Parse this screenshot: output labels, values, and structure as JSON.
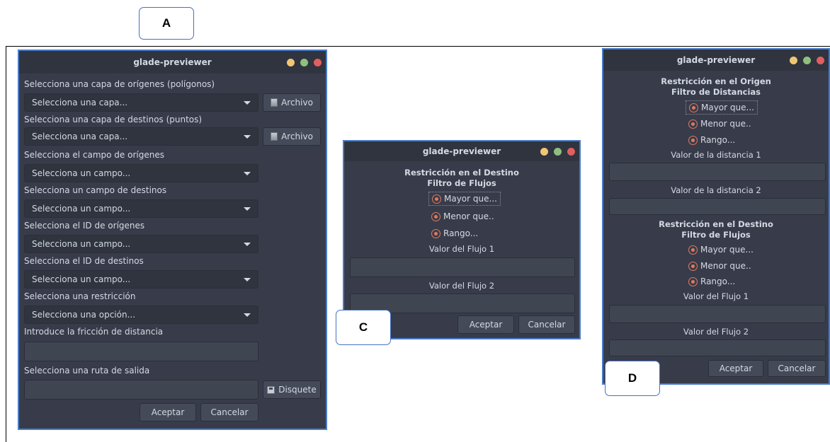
{
  "callouts": {
    "a": "A",
    "c": "C",
    "d": "D"
  },
  "colors": {
    "window_bg": "#383c4a",
    "titlebar": "#2f343f",
    "border": "#4a7cc7",
    "dot_yellow": "#f0c674",
    "dot_green": "#8fbf7f",
    "dot_red": "#e05f5f",
    "radio": "#e0795e"
  },
  "window_title": "glade-previewer",
  "win_a": {
    "label_origin_layer": "Selecciona una capa de orígenes (polígonos)",
    "combo_origin_layer": "Selecciona una capa...",
    "label_dest_layer": "Selecciona una capa de destinos (puntos)",
    "combo_dest_layer": "Selecciona una capa...",
    "archivo_label": "Archivo",
    "label_origin_field": "Selecciona el campo de orígenes",
    "combo_origin_field": "Selecciona un campo...",
    "label_dest_field": "Selecciona un campo de destinos",
    "combo_dest_field": "Selecciona un campo...",
    "label_origin_id": "Selecciona el ID de orígenes",
    "combo_origin_id": "Selecciona un campo...",
    "label_dest_id": "Selecciona el ID de destinos",
    "combo_dest_id": "Selecciona un campo...",
    "label_restriction": "Selecciona una restricción",
    "combo_restriction": "Selecciona una opción...",
    "label_friction": "Introduce la fricción de distancia",
    "label_output": "Selecciona una ruta de salida",
    "disquete_label": "Disquete",
    "accept": "Aceptar",
    "cancel": "Cancelar"
  },
  "win_c": {
    "heading1": "Restricción en el Destino",
    "heading2": "Filtro de Flujos",
    "radio_greater": "Mayor que...",
    "radio_less": "Menor que..",
    "radio_range": "Rango...",
    "label_value1": "Valor del Flujo 1",
    "label_value2": "Valor del Flujo 2",
    "accept": "Aceptar",
    "cancel": "Cancelar"
  },
  "win_d": {
    "origin_heading1": "Restricción en el Origen",
    "origin_heading2": "Filtro de Distancias",
    "radio_greater": "Mayor que...",
    "radio_less": "Menor que..",
    "radio_range": "Rango...",
    "label_dist1": "Valor de la distancia 1",
    "label_dist2": "Valor de la distancia 2",
    "dest_heading1": "Restricción en el Destino",
    "dest_heading2": "Filtro de Flujos",
    "radio2_greater": "Mayor que...",
    "radio2_less": "Menor que..",
    "radio2_range": "Rango...",
    "label_flow1": "Valor del Flujo 1",
    "label_flow2": "Valor del Flujo 2",
    "accept": "Aceptar",
    "cancel": "Cancelar"
  }
}
